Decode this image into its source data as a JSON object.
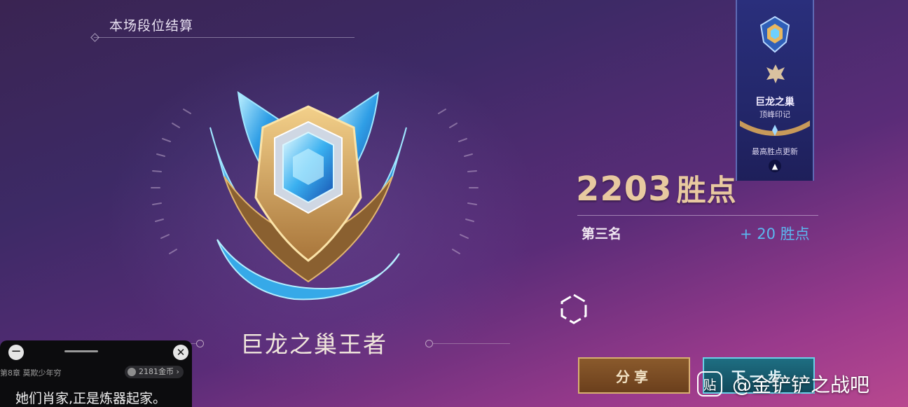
{
  "header": {
    "title": "本场段位结算"
  },
  "rank": {
    "name": "巨龙之巢王者"
  },
  "result": {
    "score_value": "2203",
    "score_unit": "胜点",
    "placement": "第三名",
    "points_gain": "+ 20 胜点"
  },
  "banner": {
    "name": "巨龙之巢",
    "subtitle": "顶峰印记",
    "best_label": "最高胜点更新"
  },
  "buttons": {
    "share": "分享",
    "next": "下一步"
  },
  "watermark": {
    "icon_char": "贴",
    "text": "@金铲铲之战吧"
  },
  "overlay": {
    "chapter": "第8章 莫欺少年穷",
    "coins": "2181金币 ›",
    "text": "她们肖家,正是炼器起家。"
  },
  "colors": {
    "score": "#e8c9a0",
    "points_gain": "#5bb8f0",
    "share_button": "#7a4c24",
    "next_button": "#1a5e72",
    "banner": "#262a70"
  },
  "icons": [
    "rank-emblem-icon",
    "loading-ring-icon",
    "crest-icon",
    "dragon-icon",
    "arrow-up-icon",
    "minus-icon",
    "close-icon",
    "coin-icon",
    "tieba-icon"
  ]
}
